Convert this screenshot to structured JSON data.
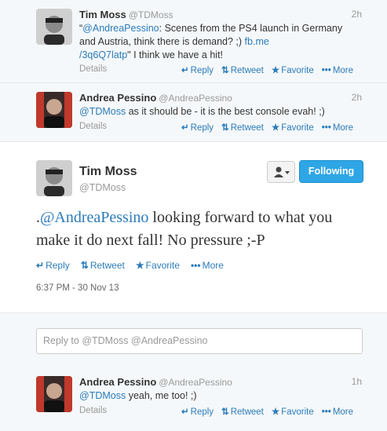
{
  "tweet1": {
    "name": "Tim Moss",
    "handle": "@TDMoss",
    "time": "2h",
    "mention": "@AndreaPessino",
    "text_a": ": Scenes from the PS4 launch in Germany and Austria, think there is demand? ;) ",
    "link1": "fb.me",
    "link2": "/3q6Q7latp",
    "text_b": "\" I think we have a hit!",
    "quote_open": "“",
    "details": "Details"
  },
  "tweet2": {
    "name": "Andrea Pessino",
    "handle": "@AndreaPessino",
    "time": "2h",
    "mention": "@TDMoss",
    "text": " as it should be - it is the best console evah! ;)",
    "details": "Details"
  },
  "main": {
    "name": "Tim Moss",
    "handle": "@TDMoss",
    "follow_label": "Following",
    "text_prefix": ".",
    "mention": "@AndreaPessino",
    "text": " looking forward to what you make it do next fall! No pressure ;-P",
    "stamp": "6:37 PM - 30 Nov 13",
    "reply_placeholder": "Reply to @TDMoss @AndreaPessino"
  },
  "tweet3": {
    "name": "Andrea Pessino",
    "handle": "@AndreaPessino",
    "time": "1h",
    "mention": "@TDMoss",
    "text": " yeah, me too! ;)",
    "details": "Details"
  },
  "actions": {
    "reply": "Reply",
    "retweet": "Retweet",
    "favorite": "Favorite",
    "more": "More"
  },
  "colors": {
    "link": "#2b7bb9",
    "follow_button": "#2ea6e6"
  }
}
